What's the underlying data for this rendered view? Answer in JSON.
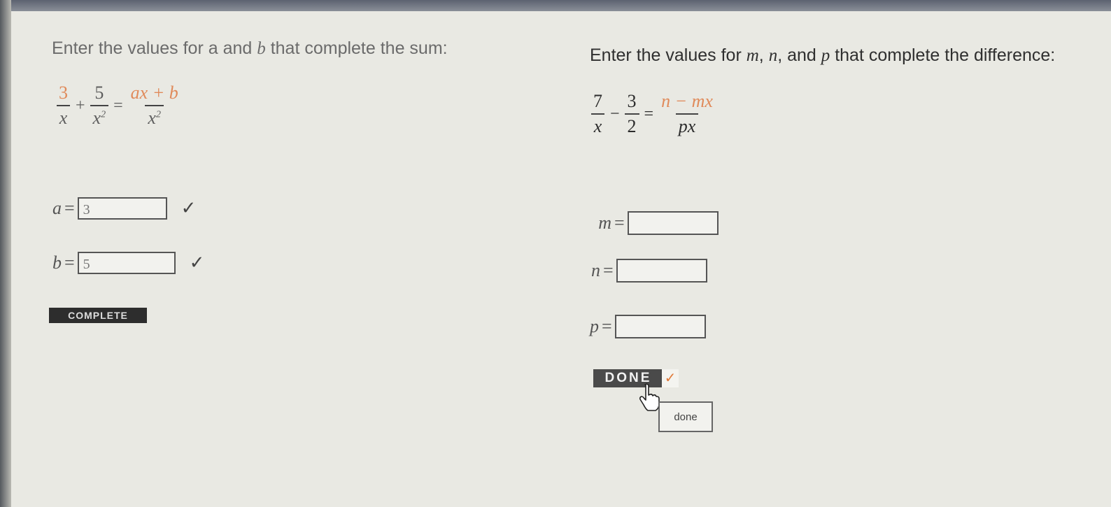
{
  "left": {
    "prompt_part1": "Enter the values for a and ",
    "prompt_var": "b",
    "prompt_part2": " that complete the sum:",
    "eq": {
      "f1_num": "3",
      "f1_den": "x",
      "op1": "+",
      "f2_num": "5",
      "f2_den": "x",
      "f2_exp": "2",
      "op2": "=",
      "f3_num_a": "ax",
      "f3_num_plus": " + ",
      "f3_num_b": "b",
      "f3_den": "x",
      "f3_exp": "2"
    },
    "a_label": "a",
    "a_value": "3",
    "b_label": "b",
    "b_value": "5",
    "equals": "=",
    "check": "✓",
    "complete_label": "COMPLETE"
  },
  "right": {
    "prompt_part1": "Enter the values for ",
    "m": "m",
    "sep1": ", ",
    "n": "n",
    "sep2": ", and ",
    "p": "p",
    "prompt_part2": " that complete the difference:",
    "eq": {
      "f1_num": "7",
      "f1_den": "x",
      "op1": "−",
      "f2_num": "3",
      "f2_den": "2",
      "op2": "=",
      "f3_num": "n − mx",
      "f3_den": "px"
    },
    "m_label": "m",
    "m_value": "",
    "n_label": "n",
    "n_value": "",
    "p_label": "p",
    "p_value": "",
    "equals": "=",
    "done_label": "DONE",
    "done_check": "✓",
    "tooltip": "done"
  },
  "colors": {
    "highlight": "#e08a5a",
    "check_orange": "#e07a3a"
  },
  "icons": {
    "pointer": "hand-pointer-icon"
  }
}
